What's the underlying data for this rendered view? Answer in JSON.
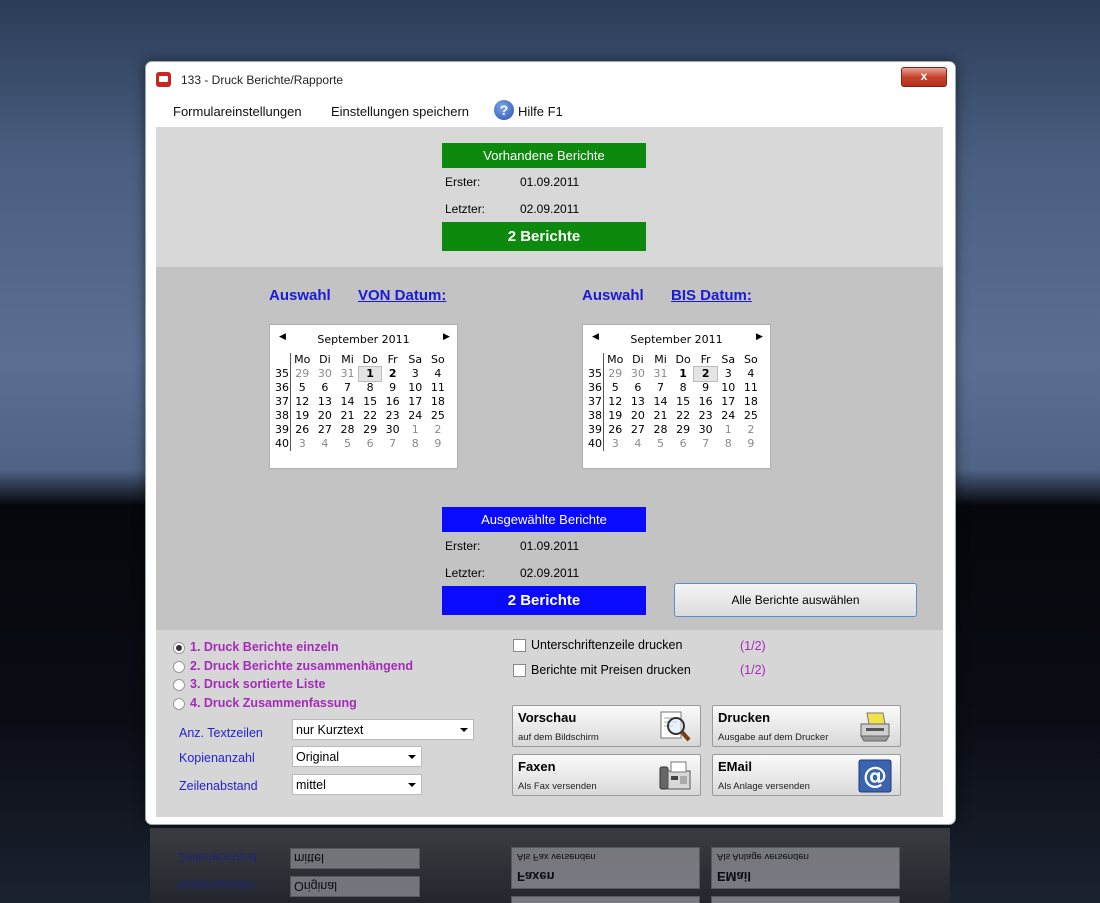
{
  "window": {
    "title": "133  -  Druck Berichte/Rapporte",
    "close": "x"
  },
  "menu": {
    "formular": "Formulareinstellungen",
    "save": "Einstellungen speichern",
    "help": "Hilfe F1",
    "help_glyph": "?"
  },
  "vorhanden": {
    "title": "Vorhandene Berichte",
    "erster_label": "Erster:",
    "erster_value": "01.09.2011",
    "letzter_label": "Letzter:",
    "letzter_value": "02.09.2011",
    "count": "2 Berichte"
  },
  "von": {
    "auswahl": "Auswahl",
    "label": "VON Datum:"
  },
  "bis": {
    "auswahl": "Auswahl",
    "label": "BIS Datum:"
  },
  "calendar": {
    "month": "September 2011",
    "weekdays": [
      "Mo",
      "Di",
      "Mi",
      "Do",
      "Fr",
      "Sa",
      "So"
    ],
    "weeks": [
      "35",
      "36",
      "37",
      "38",
      "39",
      "40"
    ],
    "days": [
      [
        "29",
        "30",
        "31",
        "1",
        "2",
        "3",
        "4"
      ],
      [
        "5",
        "6",
        "7",
        "8",
        "9",
        "10",
        "11"
      ],
      [
        "12",
        "13",
        "14",
        "15",
        "16",
        "17",
        "18"
      ],
      [
        "19",
        "20",
        "21",
        "22",
        "23",
        "24",
        "25"
      ],
      [
        "26",
        "27",
        "28",
        "29",
        "30",
        "1",
        "2"
      ],
      [
        "3",
        "4",
        "5",
        "6",
        "7",
        "8",
        "9"
      ]
    ]
  },
  "ausgewaehlt": {
    "title": "Ausgewählte Berichte",
    "erster_label": "Erster:",
    "erster_value": "01.09.2011",
    "letzter_label": "Letzter:",
    "letzter_value": "02.09.2011",
    "count": "2 Berichte"
  },
  "alle_button": "Alle Berichte auswählen",
  "radios": [
    "1. Druck Berichte einzeln",
    "2. Druck Berichte zusammenhängend",
    "3. Druck sortierte Liste",
    "4. Druck Zusammenfassung"
  ],
  "selected_radio": 0,
  "checks": [
    {
      "label": "Unterschriftenzeile drucken",
      "count": "(1/2)"
    },
    {
      "label": "Berichte mit Preisen drucken",
      "count": "(1/2)"
    }
  ],
  "fields": {
    "textzeilen_label": "Anz. Textzeilen",
    "textzeilen_value": "nur Kurztext",
    "kopien_label": "Kopienanzahl",
    "kopien_value": "Original",
    "abstand_label": "Zeilenabstand",
    "abstand_value": "mittel"
  },
  "actions": {
    "vorschau": {
      "title": "Vorschau",
      "sub": "auf dem Bildschirm"
    },
    "drucken": {
      "title": "Drucken",
      "sub": "Ausgabe auf dem Drucker"
    },
    "faxen": {
      "title": "Faxen",
      "sub": "Als Fax versenden"
    },
    "email": {
      "title": "EMail",
      "sub": "Als Anlage versenden"
    }
  },
  "colors": {
    "green": "#0d8a0d",
    "blue": "#0a0aff",
    "purple": "#a42bb8",
    "link_blue": "#1a1ad8"
  }
}
